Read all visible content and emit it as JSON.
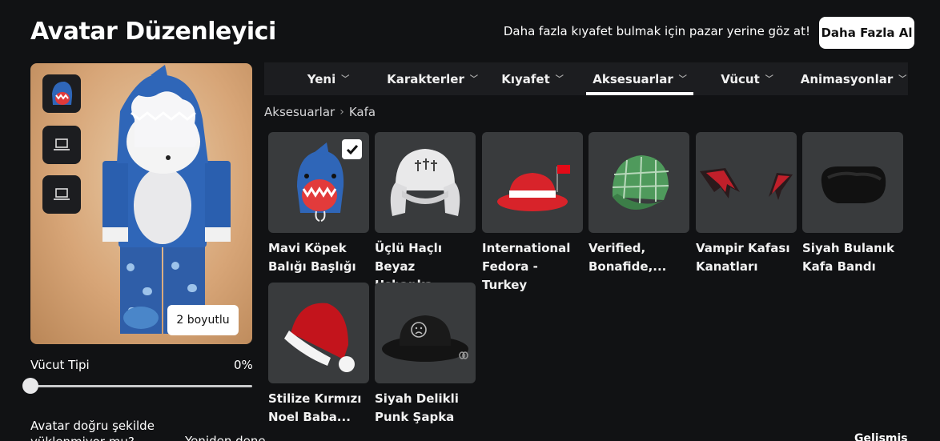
{
  "header": {
    "title": "Avatar Düzenleyici",
    "promo_text": "Daha fazla kıyafet bulmak için pazar yerine göz at!",
    "promo_button": "Daha Fazla Al"
  },
  "preview": {
    "dimension_button": "2 boyutlu",
    "slots": [
      "shark-hat-thumbnail",
      "laptop-icon",
      "laptop-icon"
    ]
  },
  "body_type": {
    "label": "Vücut Tipi",
    "value_text": "0%",
    "value": 0
  },
  "warning": {
    "text": "Avatar doğru şekilde yüklenmiyor mu?",
    "retry": "Yeniden dene"
  },
  "tabs": [
    {
      "label": "Yeni",
      "active": false
    },
    {
      "label": "Karakterler",
      "active": false
    },
    {
      "label": "Kıyafet",
      "active": false
    },
    {
      "label": "Aksesuarlar",
      "active": true
    },
    {
      "label": "Vücut",
      "active": false
    },
    {
      "label": "Animasyonlar",
      "active": false
    }
  ],
  "breadcrumb": {
    "parent": "Aksesuarlar",
    "separator": "›",
    "current": "Kafa"
  },
  "items": [
    {
      "line1": "Mavi Köpek",
      "line2": "Balığı Başlığı",
      "selected": true,
      "icon": "shark-hat"
    },
    {
      "line1": "Üçlü Haçlı Beyaz",
      "line2": "Ushanka",
      "selected": false,
      "icon": "ushanka"
    },
    {
      "line1": "International",
      "line2": "Fedora - Turkey",
      "selected": false,
      "icon": "fedora"
    },
    {
      "line1": "Verified,",
      "line2": "Bonafide,...",
      "selected": false,
      "icon": "plaid-cap"
    },
    {
      "line1": "Vampir Kafası",
      "line2": "Kanatları",
      "selected": false,
      "icon": "bat-wings"
    },
    {
      "line1": "Siyah Bulanık",
      "line2": "Kafa Bandı",
      "selected": false,
      "icon": "fuzzy-headband"
    },
    {
      "line1": "Stilize Kırmızı",
      "line2": "Noel Baba...",
      "selected": false,
      "icon": "santa-hat"
    },
    {
      "line1": "Siyah Delikli",
      "line2": "Punk Şapka",
      "selected": false,
      "icon": "bucket-hat"
    }
  ],
  "footer": {
    "advanced": "Gelişmiş"
  }
}
